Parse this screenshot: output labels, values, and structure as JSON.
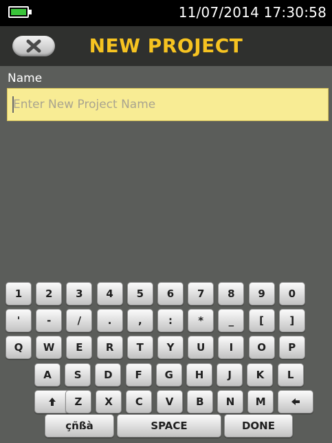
{
  "status": {
    "datetime": "11/07/2014 17:30:58",
    "battery_color": "#3ac43a"
  },
  "header": {
    "title": "NEW PROJECT",
    "back_icon": "close-icon",
    "title_color": "#f6c321"
  },
  "form": {
    "name_label": "Name",
    "name_placeholder": "Enter New Project Name",
    "name_value": ""
  },
  "keyboard": {
    "row1": [
      "1",
      "2",
      "3",
      "4",
      "5",
      "6",
      "7",
      "8",
      "9",
      "0"
    ],
    "row2": [
      "'",
      "-",
      "/",
      ".",
      ",",
      ":",
      "*",
      "_",
      "[",
      "]"
    ],
    "row3": [
      "Q",
      "W",
      "E",
      "R",
      "T",
      "Y",
      "U",
      "I",
      "O",
      "P"
    ],
    "row4": [
      "A",
      "S",
      "D",
      "F",
      "G",
      "H",
      "J",
      "K",
      "L"
    ],
    "row5": [
      "Z",
      "X",
      "C",
      "V",
      "B",
      "N",
      "M"
    ],
    "shift_icon": "arrow-up-icon",
    "backspace_icon": "arrow-left-icon",
    "lang_label": "çñßà",
    "space_label": "SPACE",
    "done_label": "DONE"
  }
}
